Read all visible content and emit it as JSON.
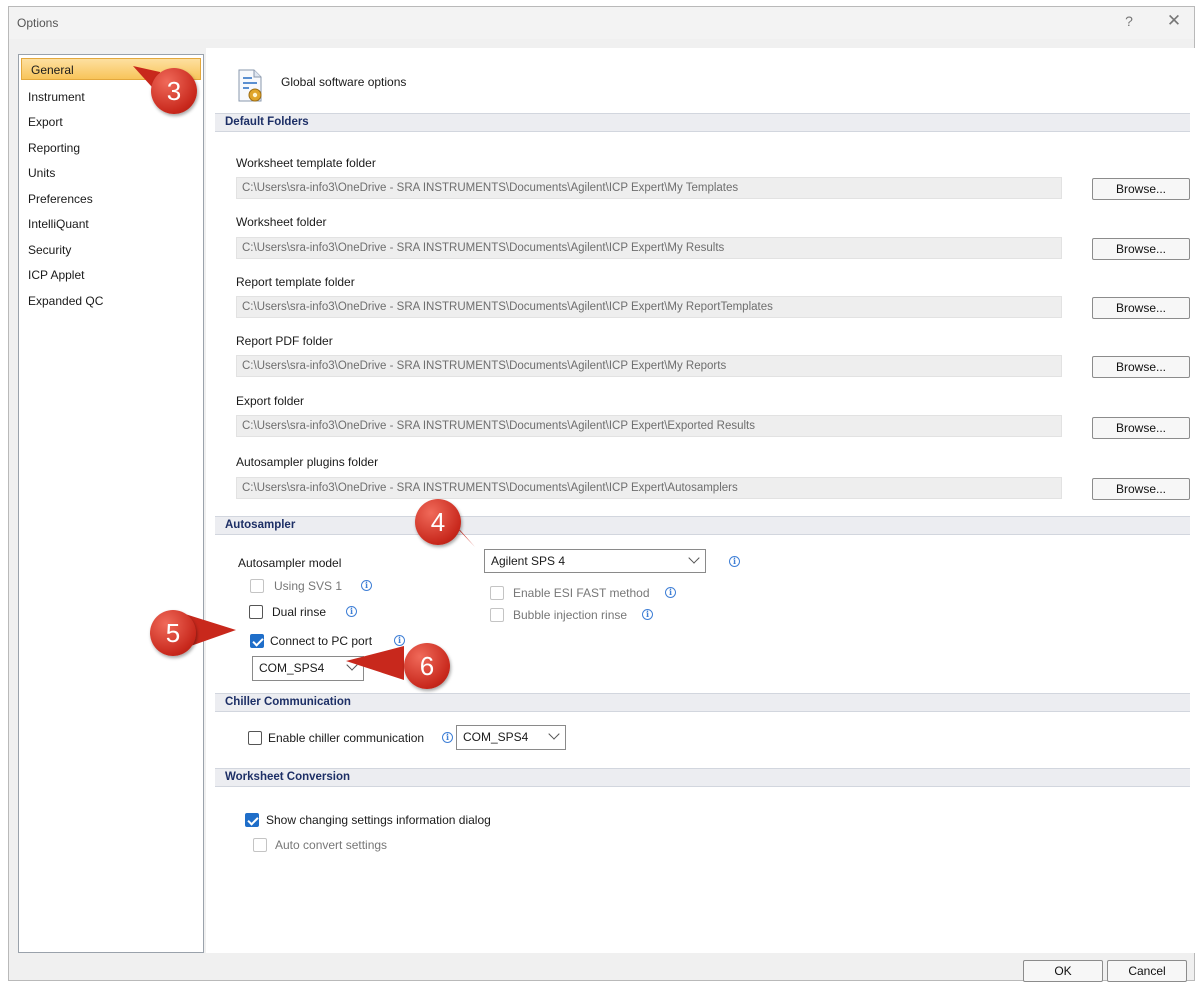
{
  "window": {
    "title": "Options",
    "help_label": "?",
    "close_label": "✕"
  },
  "nav": {
    "items": [
      {
        "label": "General",
        "selected": true
      },
      {
        "label": "Instrument"
      },
      {
        "label": "Export"
      },
      {
        "label": "Reporting"
      },
      {
        "label": "Units"
      },
      {
        "label": "Preferences"
      },
      {
        "label": "IntelliQuant"
      },
      {
        "label": "Security"
      },
      {
        "label": "ICP Applet"
      },
      {
        "label": "Expanded QC"
      }
    ]
  },
  "header": {
    "title": "Global software options",
    "icon": "settings-document-icon"
  },
  "default_folders": {
    "heading": "Default Folders",
    "browse_label": "Browse...",
    "folders": [
      {
        "label": "Worksheet template folder",
        "path": "C:\\Users\\sra-info3\\OneDrive - SRA INSTRUMENTS\\Documents\\Agilent\\ICP Expert\\My Templates"
      },
      {
        "label": "Worksheet folder",
        "path": "C:\\Users\\sra-info3\\OneDrive - SRA INSTRUMENTS\\Documents\\Agilent\\ICP Expert\\My Results"
      },
      {
        "label": "Report template folder",
        "path": "C:\\Users\\sra-info3\\OneDrive - SRA INSTRUMENTS\\Documents\\Agilent\\ICP Expert\\My ReportTemplates"
      },
      {
        "label": "Report PDF folder",
        "path": "C:\\Users\\sra-info3\\OneDrive - SRA INSTRUMENTS\\Documents\\Agilent\\ICP Expert\\My Reports"
      },
      {
        "label": "Export folder",
        "path": "C:\\Users\\sra-info3\\OneDrive - SRA INSTRUMENTS\\Documents\\Agilent\\ICP Expert\\Exported Results"
      },
      {
        "label": "Autosampler plugins folder",
        "path": "C:\\Users\\sra-info3\\OneDrive - SRA INSTRUMENTS\\Documents\\Agilent\\ICP Expert\\Autosamplers"
      }
    ]
  },
  "autosampler": {
    "heading": "Autosampler",
    "model_label": "Autosampler model",
    "model_value": "Agilent SPS 4",
    "using_svs1": {
      "label": "Using SVS 1",
      "checked": false,
      "enabled": false
    },
    "dual_rinse": {
      "label": "Dual rinse",
      "checked": false,
      "enabled": true
    },
    "connect_pc": {
      "label": "Connect to PC port",
      "checked": true,
      "enabled": true
    },
    "port_value": "COM_SPS4",
    "esi_fast": {
      "label": "Enable ESI FAST method",
      "checked": false,
      "enabled": false
    },
    "bubble_rinse": {
      "label": "Bubble injection rinse",
      "checked": false,
      "enabled": false
    }
  },
  "chiller": {
    "heading": "Chiller Communication",
    "enable": {
      "label": "Enable chiller communication",
      "checked": false
    },
    "port_value": "COM_SPS4"
  },
  "worksheet_conversion": {
    "heading": "Worksheet Conversion",
    "show_info": {
      "label": "Show changing settings information dialog",
      "checked": true
    },
    "auto_convert": {
      "label": "Auto convert settings",
      "checked": false,
      "enabled": false
    }
  },
  "footer": {
    "ok_label": "OK",
    "cancel_label": "Cancel"
  },
  "callouts": {
    "c3": "3",
    "c4": "4",
    "c5": "5",
    "c6": "6"
  },
  "colors": {
    "accent": "#1f6ec9",
    "callout": "#c8281c",
    "section_text": "#1d2f66",
    "nav_selected": "#f8c45a"
  }
}
